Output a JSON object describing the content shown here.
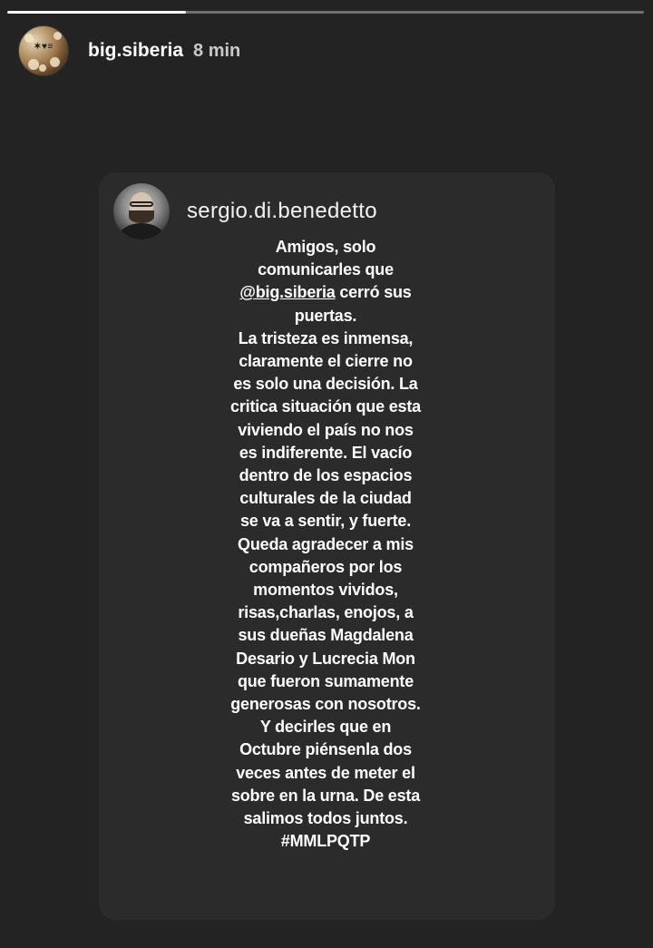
{
  "story": {
    "progress": 0.28,
    "account": {
      "username": "big.siberia",
      "time_ago": "8 min",
      "avatar_icon": "big-siberia-logo-icon"
    }
  },
  "shared_post": {
    "author": {
      "username": "sergio.di.benedetto",
      "avatar_icon": "profile-photo-icon"
    },
    "text_lines": [
      "Amigos, solo",
      "comunicarles que",
      "@big.siberia  cerró sus",
      "puertas.",
      "La tristeza es inmensa,",
      "claramente el cierre no",
      "es solo una decisión. La",
      "critica situación que esta",
      "viviendo el país no nos",
      "es indiferente. El vacío",
      "dentro de los espacios",
      "culturales de la ciudad",
      "se va a sentir, y fuerte.",
      "Queda agradecer a mis",
      "compañeros por los",
      "momentos vividos,",
      "risas,charlas, enojos, a",
      "sus dueñas Magdalena",
      "Desario y Lucrecia Mon",
      "que fueron sumamente",
      "generosas con nosotros.",
      "  Y decirles que en",
      "Octubre piénsenla dos",
      "veces antes de meter el",
      "sobre en la urna. De esta",
      "salimos todos juntos.",
      "#MMLPQTP"
    ]
  },
  "colors": {
    "background": "#232323",
    "card": "#2b2b2b",
    "text": "#ffffff"
  }
}
